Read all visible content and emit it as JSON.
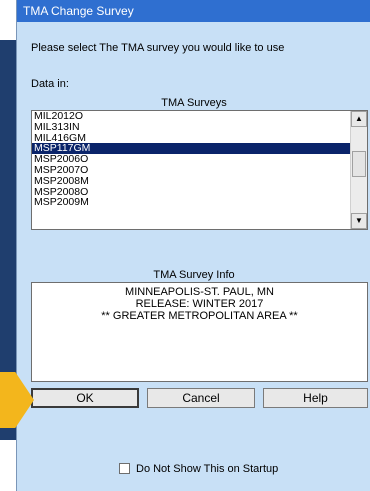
{
  "window": {
    "title": "TMA Change Survey"
  },
  "prompt": "Please select The TMA survey you would like to use",
  "data_in_label": "Data in:",
  "surveys": {
    "title": "TMA Surveys",
    "items": [
      "MIL2012O",
      "MIL313IN",
      "MIL416GM",
      "MSP117GM",
      "MSP2006O",
      "MSP2007O",
      "MSP2008M",
      "MSP2008O",
      "MSP2009M"
    ],
    "selected": "MSP117GM"
  },
  "survey_info": {
    "title": "TMA Survey Info",
    "lines": [
      "MINNEAPOLIS-ST. PAUL, MN",
      "RELEASE: WINTER 2017",
      "** GREATER METROPOLITAN AREA **"
    ]
  },
  "buttons": {
    "ok": "OK",
    "cancel": "Cancel",
    "help": "Help"
  },
  "startup_checkbox": {
    "label": "Do Not Show This on Startup",
    "checked": false
  },
  "colors": {
    "dialog_bg": "#c8e0f6",
    "title_bar": "#2f6fd0",
    "selection": "#0a246a",
    "pointer": "#f3b61c"
  }
}
